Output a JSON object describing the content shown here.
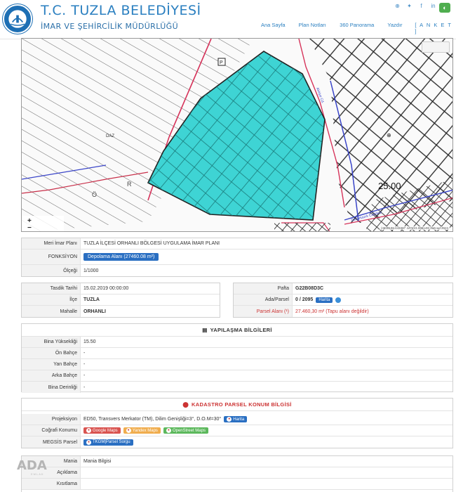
{
  "header": {
    "title": "T.C. TUZLA BELEDİYESİ",
    "subtitle": "İMAR VE ŞEHİRCİLİK MÜDÜRLÜĞÜ",
    "nav": [
      "Ana Sayfa",
      "Plan Notları",
      "360 Panorama",
      "Yazdır",
      "[ A N K E T ]"
    ],
    "social_icons": [
      "globe-icon",
      "twitter-icon",
      "facebook-icon",
      "linkedin-icon"
    ]
  },
  "map": {
    "coords": "(4639196.442367 447423.065149) Netcad 2022",
    "road_label": "25.00",
    "zoom_in": "+",
    "zoom_out": "−"
  },
  "plan": {
    "rows": [
      {
        "label": "Meri İmar Planı",
        "value": "TUZLA İLÇESİ ORHANLI BÖLGESİ UYGULAMA İMAR PLANI"
      },
      {
        "label": "FONKSİYON",
        "value": "Depolama Alanı (27460.08 m²)"
      },
      {
        "label": "Ölçeği",
        "value": "1/1000"
      }
    ]
  },
  "parcel_left": {
    "rows": [
      {
        "label": "Tasdik Tarihi",
        "value": "15.02.2019 00:00:00"
      },
      {
        "label": "İlçe",
        "value": "TUZLA"
      },
      {
        "label": "Mahalle",
        "value": "ORHANLI"
      }
    ]
  },
  "parcel_right": {
    "pafta_label": "Pafta",
    "pafta_value": "G22B08D3C",
    "ada_label": "Ada/Parsel",
    "ada_value": "0 / 2095",
    "harita_btn": "Harita",
    "alan_label": "Parsel Alanı (¹)",
    "alan_value": "27.460,30 m² (Tapu alanı değildir)"
  },
  "yapilasma": {
    "title": "YAPILAŞMA BİLGİLERİ",
    "rows": [
      {
        "label": "Bina Yüksekliği",
        "value": "15.50"
      },
      {
        "label": "Ön Bahçe",
        "value": "-"
      },
      {
        "label": "Yan Bahçe",
        "value": "-"
      },
      {
        "label": "Arka Bahçe",
        "value": "-"
      },
      {
        "label": "Bina Derinliği",
        "value": "-"
      }
    ]
  },
  "kadastro": {
    "title": "KADASTRO PARSEL KONUM BİLGİSİ",
    "projeksiyon_label": "Projeksiyon",
    "projeksiyon_value": "ED50, Transvers Merkator (TM), Dilim Genişliği=3°, D.O.M=30°",
    "harita_btn": "Harita",
    "cografi_label": "Coğrafi Konumu",
    "google": "Google Maps",
    "yandex": "Yandex Maps",
    "osm": "OpenStreet Maps",
    "megsis_label": "MEGSİS Parsel",
    "tkgm": "TKGM|Parsel Sorgu"
  },
  "extra": {
    "rows": [
      {
        "label": "Mania",
        "value": "Mania Bilgisi"
      },
      {
        "label": "Açıklama",
        "value": ""
      },
      {
        "label": "Kısıtlama",
        "value": ""
      }
    ]
  },
  "watermark": {
    "ada": "ADA",
    "sub": "EMLAK"
  },
  "colors": {
    "accent": "#2a7fc0",
    "parcel": "#3ed4d4",
    "button": "#2a6fc2",
    "red": "#c33333"
  }
}
